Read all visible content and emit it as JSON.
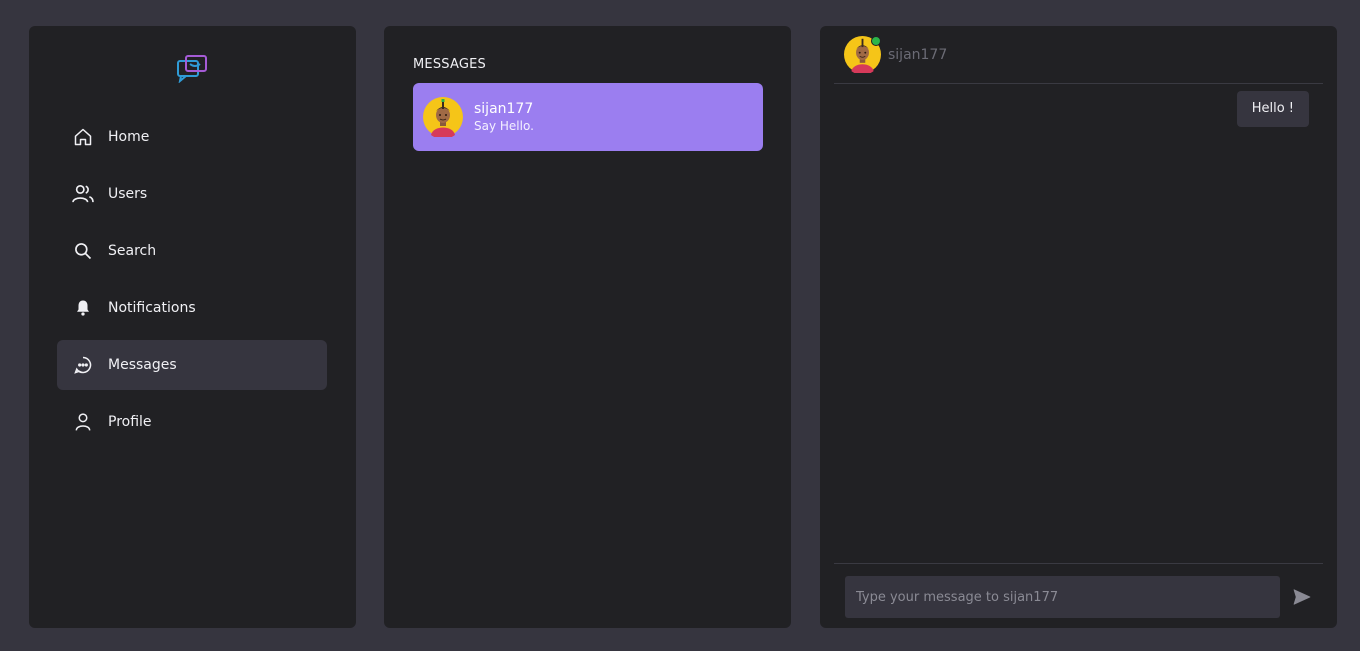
{
  "sidebar": {
    "logo": "chat-logo-icon",
    "items": [
      {
        "label": "Home",
        "icon": "home-icon"
      },
      {
        "label": "Users",
        "icon": "users-icon"
      },
      {
        "label": "Search",
        "icon": "search-icon"
      },
      {
        "label": "Notifications",
        "icon": "bell-icon"
      },
      {
        "label": "Messages",
        "icon": "message-icon",
        "active": true
      },
      {
        "label": "Profile",
        "icon": "user-icon"
      }
    ]
  },
  "conversations": {
    "title": "MESSAGES",
    "items": [
      {
        "name": "sijan177",
        "preview": "Say Hello.",
        "accent": "#9b7ef0"
      }
    ]
  },
  "chat": {
    "user": "sijan177",
    "online": true,
    "messages": [
      {
        "text": "Hello !",
        "outgoing": true
      }
    ],
    "input": {
      "value": "",
      "placeholder": "Type your message to sijan177"
    },
    "send_icon": "send-icon"
  },
  "colors": {
    "background": "#36353f",
    "panel": "#212124",
    "accent": "#9b7ef0",
    "online": "#2bb54a"
  }
}
